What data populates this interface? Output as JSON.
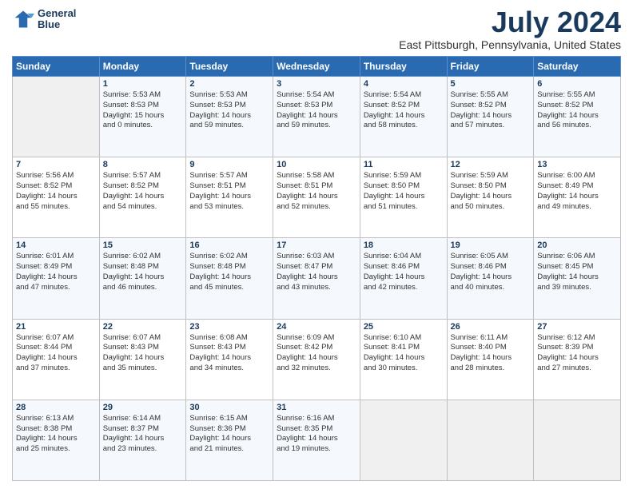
{
  "header": {
    "logo_line1": "General",
    "logo_line2": "Blue",
    "main_title": "July 2024",
    "subtitle": "East Pittsburgh, Pennsylvania, United States"
  },
  "calendar": {
    "headers": [
      "Sunday",
      "Monday",
      "Tuesday",
      "Wednesday",
      "Thursday",
      "Friday",
      "Saturday"
    ],
    "weeks": [
      [
        {
          "day": "",
          "info": ""
        },
        {
          "day": "1",
          "info": "Sunrise: 5:53 AM\nSunset: 8:53 PM\nDaylight: 15 hours\nand 0 minutes."
        },
        {
          "day": "2",
          "info": "Sunrise: 5:53 AM\nSunset: 8:53 PM\nDaylight: 14 hours\nand 59 minutes."
        },
        {
          "day": "3",
          "info": "Sunrise: 5:54 AM\nSunset: 8:53 PM\nDaylight: 14 hours\nand 59 minutes."
        },
        {
          "day": "4",
          "info": "Sunrise: 5:54 AM\nSunset: 8:52 PM\nDaylight: 14 hours\nand 58 minutes."
        },
        {
          "day": "5",
          "info": "Sunrise: 5:55 AM\nSunset: 8:52 PM\nDaylight: 14 hours\nand 57 minutes."
        },
        {
          "day": "6",
          "info": "Sunrise: 5:55 AM\nSunset: 8:52 PM\nDaylight: 14 hours\nand 56 minutes."
        }
      ],
      [
        {
          "day": "7",
          "info": "Sunrise: 5:56 AM\nSunset: 8:52 PM\nDaylight: 14 hours\nand 55 minutes."
        },
        {
          "day": "8",
          "info": "Sunrise: 5:57 AM\nSunset: 8:52 PM\nDaylight: 14 hours\nand 54 minutes."
        },
        {
          "day": "9",
          "info": "Sunrise: 5:57 AM\nSunset: 8:51 PM\nDaylight: 14 hours\nand 53 minutes."
        },
        {
          "day": "10",
          "info": "Sunrise: 5:58 AM\nSunset: 8:51 PM\nDaylight: 14 hours\nand 52 minutes."
        },
        {
          "day": "11",
          "info": "Sunrise: 5:59 AM\nSunset: 8:50 PM\nDaylight: 14 hours\nand 51 minutes."
        },
        {
          "day": "12",
          "info": "Sunrise: 5:59 AM\nSunset: 8:50 PM\nDaylight: 14 hours\nand 50 minutes."
        },
        {
          "day": "13",
          "info": "Sunrise: 6:00 AM\nSunset: 8:49 PM\nDaylight: 14 hours\nand 49 minutes."
        }
      ],
      [
        {
          "day": "14",
          "info": "Sunrise: 6:01 AM\nSunset: 8:49 PM\nDaylight: 14 hours\nand 47 minutes."
        },
        {
          "day": "15",
          "info": "Sunrise: 6:02 AM\nSunset: 8:48 PM\nDaylight: 14 hours\nand 46 minutes."
        },
        {
          "day": "16",
          "info": "Sunrise: 6:02 AM\nSunset: 8:48 PM\nDaylight: 14 hours\nand 45 minutes."
        },
        {
          "day": "17",
          "info": "Sunrise: 6:03 AM\nSunset: 8:47 PM\nDaylight: 14 hours\nand 43 minutes."
        },
        {
          "day": "18",
          "info": "Sunrise: 6:04 AM\nSunset: 8:46 PM\nDaylight: 14 hours\nand 42 minutes."
        },
        {
          "day": "19",
          "info": "Sunrise: 6:05 AM\nSunset: 8:46 PM\nDaylight: 14 hours\nand 40 minutes."
        },
        {
          "day": "20",
          "info": "Sunrise: 6:06 AM\nSunset: 8:45 PM\nDaylight: 14 hours\nand 39 minutes."
        }
      ],
      [
        {
          "day": "21",
          "info": "Sunrise: 6:07 AM\nSunset: 8:44 PM\nDaylight: 14 hours\nand 37 minutes."
        },
        {
          "day": "22",
          "info": "Sunrise: 6:07 AM\nSunset: 8:43 PM\nDaylight: 14 hours\nand 35 minutes."
        },
        {
          "day": "23",
          "info": "Sunrise: 6:08 AM\nSunset: 8:43 PM\nDaylight: 14 hours\nand 34 minutes."
        },
        {
          "day": "24",
          "info": "Sunrise: 6:09 AM\nSunset: 8:42 PM\nDaylight: 14 hours\nand 32 minutes."
        },
        {
          "day": "25",
          "info": "Sunrise: 6:10 AM\nSunset: 8:41 PM\nDaylight: 14 hours\nand 30 minutes."
        },
        {
          "day": "26",
          "info": "Sunrise: 6:11 AM\nSunset: 8:40 PM\nDaylight: 14 hours\nand 28 minutes."
        },
        {
          "day": "27",
          "info": "Sunrise: 6:12 AM\nSunset: 8:39 PM\nDaylight: 14 hours\nand 27 minutes."
        }
      ],
      [
        {
          "day": "28",
          "info": "Sunrise: 6:13 AM\nSunset: 8:38 PM\nDaylight: 14 hours\nand 25 minutes."
        },
        {
          "day": "29",
          "info": "Sunrise: 6:14 AM\nSunset: 8:37 PM\nDaylight: 14 hours\nand 23 minutes."
        },
        {
          "day": "30",
          "info": "Sunrise: 6:15 AM\nSunset: 8:36 PM\nDaylight: 14 hours\nand 21 minutes."
        },
        {
          "day": "31",
          "info": "Sunrise: 6:16 AM\nSunset: 8:35 PM\nDaylight: 14 hours\nand 19 minutes."
        },
        {
          "day": "",
          "info": ""
        },
        {
          "day": "",
          "info": ""
        },
        {
          "day": "",
          "info": ""
        }
      ]
    ]
  }
}
